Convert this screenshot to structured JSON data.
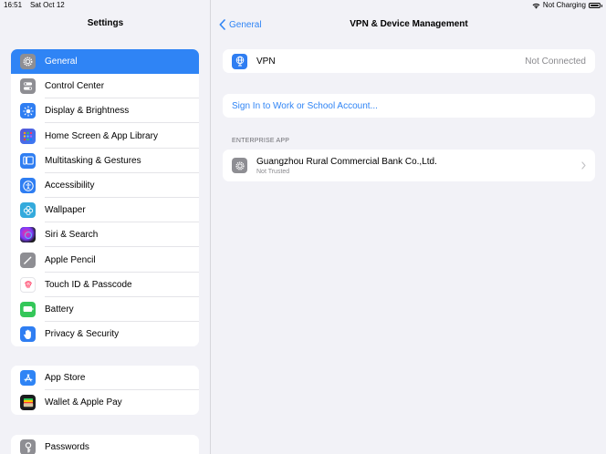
{
  "status": {
    "time": "16:51",
    "date": "Sat Oct 12",
    "charging": "Not Charging",
    "icons": [
      "wifi-icon",
      "battery-icon"
    ]
  },
  "sidebar": {
    "title": "Settings",
    "groups": [
      [
        {
          "label": "General",
          "icon": "gear-icon",
          "color": "#8e8e93",
          "selected": true
        },
        {
          "label": "Control Center",
          "icon": "toggles-icon",
          "color": "#8e8e93"
        },
        {
          "label": "Display & Brightness",
          "icon": "sun-icon",
          "color": "#2f7ef2"
        },
        {
          "label": "Home Screen & App Library",
          "icon": "grid-icon",
          "color": "#5856d6"
        },
        {
          "label": "Multitasking & Gestures",
          "icon": "multitasking-icon",
          "color": "#2f7ef2"
        },
        {
          "label": "Accessibility",
          "icon": "accessibility-icon",
          "color": "#2f7ef2"
        },
        {
          "label": "Wallpaper",
          "icon": "flower-icon",
          "color": "#34aadc"
        },
        {
          "label": "Siri & Search",
          "icon": "siri-icon",
          "color": "#1c1c1e"
        },
        {
          "label": "Apple Pencil",
          "icon": "pencil-icon",
          "color": "#8e8e93"
        },
        {
          "label": "Touch ID & Passcode",
          "icon": "fingerprint-icon",
          "color": "#ffffff"
        },
        {
          "label": "Battery",
          "icon": "battery-app-icon",
          "color": "#34c759"
        },
        {
          "label": "Privacy & Security",
          "icon": "hand-icon",
          "color": "#2f7ef2"
        }
      ],
      [
        {
          "label": "App Store",
          "icon": "app-store-icon",
          "color": "#2f84f5"
        },
        {
          "label": "Wallet & Apple Pay",
          "icon": "wallet-icon",
          "color": "#1c1c1e"
        }
      ],
      [
        {
          "label": "Passwords",
          "icon": "key-icon",
          "color": "#8e8e93"
        }
      ]
    ]
  },
  "detail": {
    "back_label": "General",
    "title": "VPN & Device Management",
    "vpn": {
      "label": "VPN",
      "value": "Not Connected"
    },
    "signin_label": "Sign In to Work or School Account...",
    "section_header": "ENTERPRISE APP",
    "enterprise_app": {
      "name": "Guangzhou Rural Commercial Bank Co.,Ltd.",
      "status": "Not Trusted"
    }
  }
}
